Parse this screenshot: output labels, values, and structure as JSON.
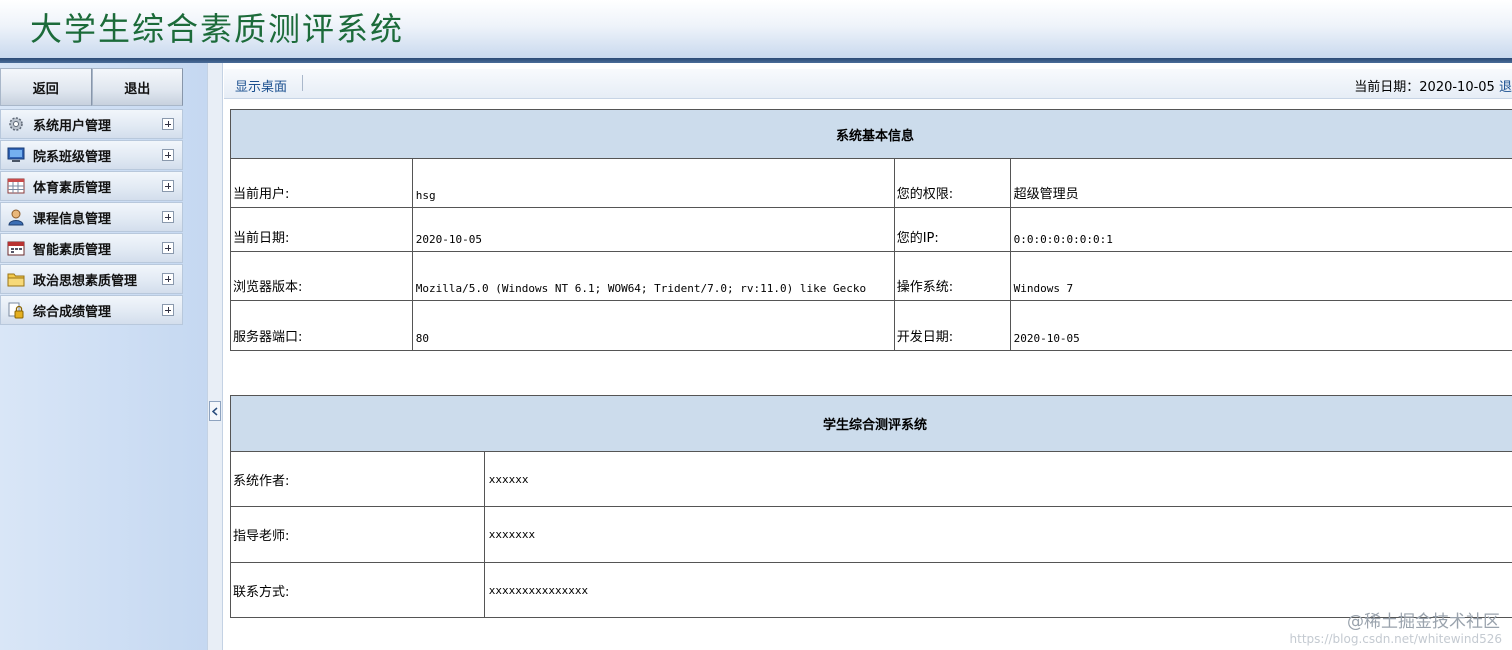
{
  "header": {
    "title": "大学生综合素质测评系统"
  },
  "sidebar": {
    "back_label": "返回",
    "exit_label": "退出",
    "items": [
      {
        "label": "系统用户管理",
        "icon": "gear-icon"
      },
      {
        "label": "院系班级管理",
        "icon": "computer-icon"
      },
      {
        "label": "体育素质管理",
        "icon": "table-icon"
      },
      {
        "label": "课程信息管理",
        "icon": "user-icon"
      },
      {
        "label": "智能素质管理",
        "icon": "calendar-icon"
      },
      {
        "label": "政治思想素质管理",
        "icon": "folder-icon"
      },
      {
        "label": "综合成绩管理",
        "icon": "lock-icon"
      }
    ]
  },
  "toolbar": {
    "desktop_link": "显示桌面",
    "date_prefix": "当前日期：2020-10-05",
    "logout_label": "退"
  },
  "system_info": {
    "heading": "系统基本信息",
    "rows": [
      {
        "l1": "当前用户:",
        "v1": "hsg",
        "l2": "您的权限:",
        "v2": "超级管理员"
      },
      {
        "l1": "当前日期:",
        "v1": "2020-10-05",
        "l2": "您的IP:",
        "v2": "0:0:0:0:0:0:0:1"
      },
      {
        "l1": "浏览器版本:",
        "v1": "Mozilla/5.0 (Windows NT 6.1; WOW64; Trident/7.0; rv:11.0) like Gecko",
        "l2": "操作系统:",
        "v2": "Windows 7"
      },
      {
        "l1": "服务器端口:",
        "v1": "80",
        "l2": "开发日期:",
        "v2": "2020-10-05"
      }
    ]
  },
  "about": {
    "heading": "学生综合测评系统",
    "rows": [
      {
        "label": "系统作者:",
        "value": "xxxxxx"
      },
      {
        "label": "指导老师:",
        "value": "xxxxxxx"
      },
      {
        "label": "联系方式:",
        "value": "xxxxxxxxxxxxxxx"
      }
    ]
  },
  "watermark": {
    "text": "@稀土掘金技术社区",
    "url": "https://blog.csdn.net/whitewind526"
  }
}
